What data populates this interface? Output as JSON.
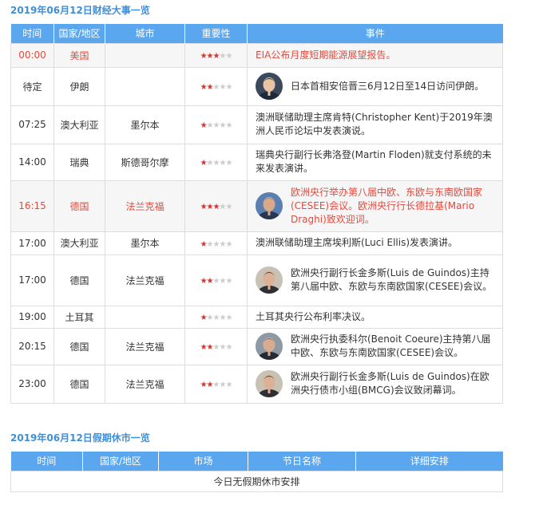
{
  "econ": {
    "title": "2019年06月12日财经大事一览",
    "headers": [
      "时间",
      "国家/地区",
      "城市",
      "重要性",
      "事件"
    ],
    "rows": [
      {
        "time": "00:00",
        "country": "美国",
        "city": "",
        "stars": 3,
        "event": "EIA公布月度短期能源展望报告。",
        "highlight": true,
        "avatar": ""
      },
      {
        "time": "待定",
        "country": "伊朗",
        "city": "",
        "stars": 2,
        "event": "日本首相安倍晋三6月12日至14日访问伊朗。",
        "highlight": false,
        "avatar": "abe"
      },
      {
        "time": "07:25",
        "country": "澳大利亚",
        "city": "墨尔本",
        "stars": 1,
        "event": "澳洲联储助理主席肯特(Christopher Kent)于2019年澳洲人民币论坛中发表演说。",
        "highlight": false,
        "avatar": ""
      },
      {
        "time": "14:00",
        "country": "瑞典",
        "city": "斯德哥尔摩",
        "stars": 1,
        "event": "瑞典央行副行长弗洛登(Martin Floden)就支付系统的未来发表演讲。",
        "highlight": false,
        "avatar": ""
      },
      {
        "time": "16:15",
        "country": "德国",
        "city": "法兰克福",
        "stars": 3,
        "event": "欧洲央行举办第八届中欧、东欧与东南欧国家(CESEE)会议。欧洲央行行长德拉基(Mario Draghi)致欢迎词。",
        "highlight": true,
        "avatar": "draghi"
      },
      {
        "time": "17:00",
        "country": "澳大利亚",
        "city": "墨尔本",
        "stars": 1,
        "event": "澳洲联储助理主席埃利斯(Luci Ellis)发表演讲。",
        "highlight": false,
        "avatar": ""
      },
      {
        "time": "17:00",
        "country": "德国",
        "city": "法兰克福",
        "stars": 2,
        "event": "欧洲央行副行长金多斯(Luis de Guindos)主持第八届中欧、东欧与东南欧国家(CESEE)会议。",
        "highlight": false,
        "avatar": "guindos"
      },
      {
        "time": "19:00",
        "country": "土耳其",
        "city": "",
        "stars": 1,
        "event": "土耳其央行公布利率决议。",
        "highlight": false,
        "avatar": ""
      },
      {
        "time": "20:15",
        "country": "德国",
        "city": "法兰克福",
        "stars": 2,
        "event": "欧洲央行执委科尔(Benoit Coeure)主持第八届中欧、东欧与东南欧国家(CESEE)会议。",
        "highlight": false,
        "avatar": "coeure"
      },
      {
        "time": "23:00",
        "country": "德国",
        "city": "法兰克福",
        "stars": 2,
        "event": "欧洲央行副行长金多斯(Luis de Guindos)在欧洲央行债市小组(BMCG)会议致闭幕词。",
        "highlight": false,
        "avatar": "guindos"
      }
    ]
  },
  "holiday": {
    "title": "2019年06月12日假期休市一览",
    "headers": [
      "时间",
      "国家/地区",
      "市场",
      "节日名称",
      "详细安排"
    ],
    "empty_message": "今日无假期休市安排"
  },
  "colors": {
    "accent": "#3f8fd8",
    "header_bg": "#5aa7f0",
    "highlight_text": "#e14b3e",
    "star_on": "#d9332f",
    "star_off": "#cccccc"
  }
}
